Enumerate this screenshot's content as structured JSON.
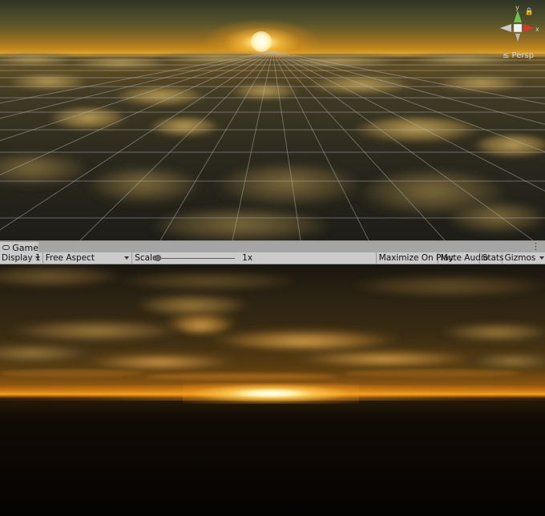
{
  "scene_view": {
    "persp_label": "≤ Persp",
    "gizmo": {
      "y_label": "y",
      "x_label": "x",
      "lock_icon": "lock-icon"
    }
  },
  "game_tab": {
    "label": "Game",
    "icon": "gamepad-icon",
    "menu_icon": "⋮"
  },
  "toolbar": {
    "display": "Display 1",
    "aspect": "Free Aspect",
    "scale_label": "Scale",
    "scale_value": "1x",
    "scale_fraction": 0.0,
    "maximize_on_play": "Maximize On Play",
    "mute_audio": "Mute Audio",
    "stats": "Stats",
    "gizmos": "Gizmos"
  },
  "colors": {
    "toolbar_bg": "#cbcbcb",
    "tab_bg": "#c8c8c8",
    "gizmo_x": "#d23a2c",
    "gizmo_y": "#6cc24a",
    "sun": "#ffe27a"
  }
}
